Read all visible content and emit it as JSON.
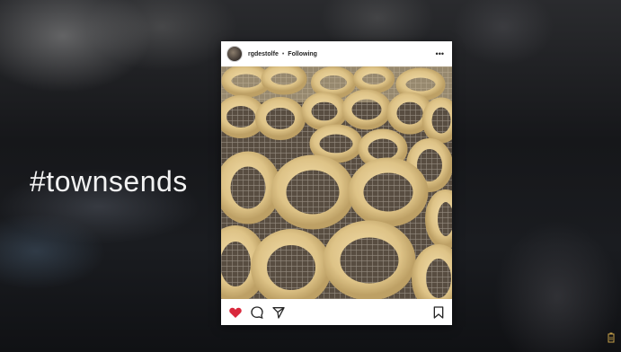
{
  "overlay": {
    "hashtag": "#townsends"
  },
  "post": {
    "username": "rgdestolfe",
    "separator": "•",
    "follow_status": "Following",
    "more_icon": "more-dots-icon",
    "photo_subject": "ring-shaped dough cookies on a wire cooling rack",
    "actions": {
      "like_icon": "heart-icon",
      "like_color": "#d9283c",
      "comment_icon": "comment-icon",
      "share_icon": "share-icon",
      "save_icon": "bookmark-icon"
    }
  },
  "colors": {
    "post_background": "#ffffff",
    "hashtag_text": "#f2f2f2",
    "cookie": "#e3c98e"
  }
}
